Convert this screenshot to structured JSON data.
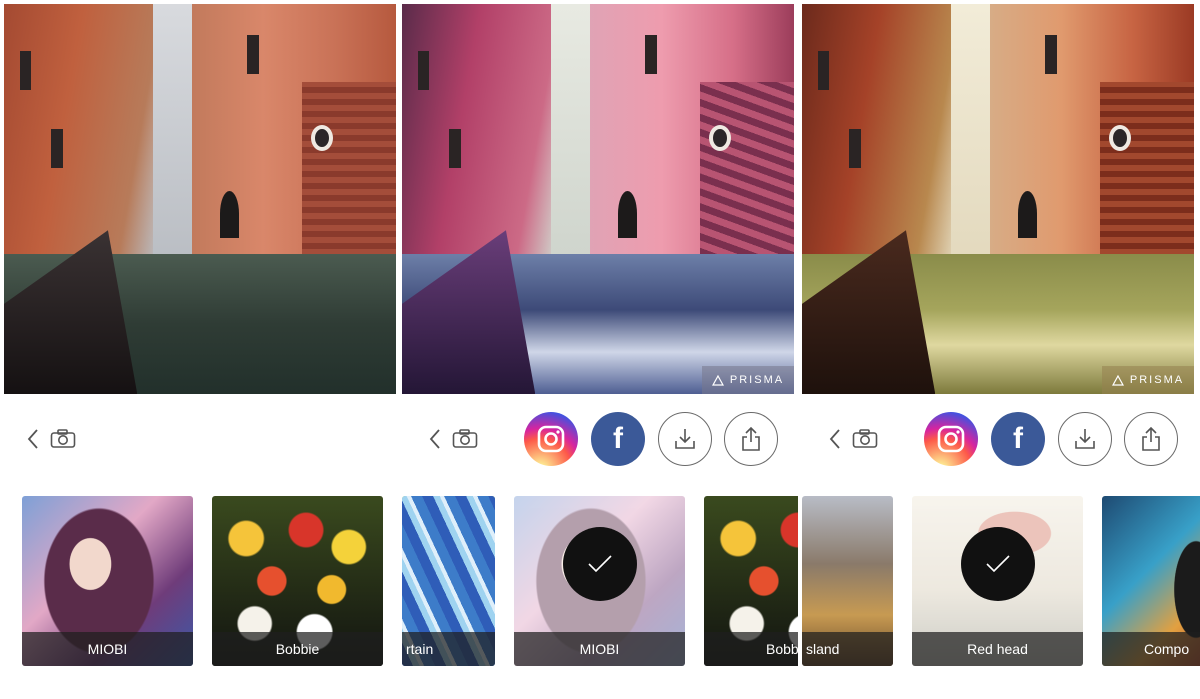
{
  "colors": {
    "facebook": "#3b5998",
    "checkmark_bg": "#111111",
    "label_bg": "#1e1e1e"
  },
  "panels": [
    {
      "id": "original",
      "toolbar": {
        "icons": [
          "chevron-left-icon",
          "camera-icon"
        ]
      },
      "filters": [
        {
          "label": "MIOBI",
          "art": "portrait"
        },
        {
          "label": "Bobbie",
          "art": "flowers"
        }
      ]
    },
    {
      "id": "filtered-miobi",
      "watermark": "PRISMA",
      "toolbar": {
        "icons": [
          "chevron-left-icon",
          "camera-icon",
          "instagram-icon",
          "facebook-icon",
          "download-icon",
          "share-icon"
        ]
      },
      "facebook_letter": "f",
      "filters": [
        {
          "label": "rtain",
          "art": "curtain"
        },
        {
          "label": "MIOBI",
          "art": "portrait",
          "selected": true
        },
        {
          "label": "Bobbie",
          "art": "flowers"
        }
      ]
    },
    {
      "id": "filtered-redhead",
      "watermark": "PRISMA",
      "toolbar": {
        "icons": [
          "chevron-left-icon",
          "camera-icon",
          "instagram-icon",
          "facebook-icon",
          "download-icon",
          "share-icon"
        ]
      },
      "facebook_letter": "f",
      "filters": [
        {
          "label": "sland",
          "art": "island"
        },
        {
          "label": "Red head",
          "art": "redhead",
          "selected": true
        },
        {
          "label": "Compo",
          "art": "compo"
        }
      ]
    }
  ]
}
